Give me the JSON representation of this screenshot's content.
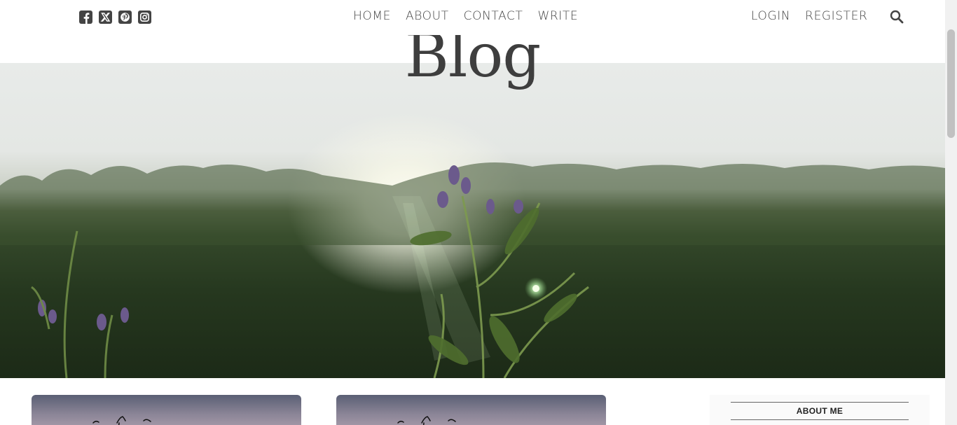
{
  "social": {
    "icons": [
      "facebook-icon",
      "x-twitter-icon",
      "pinterest-icon",
      "instagram-icon"
    ]
  },
  "nav": {
    "items": [
      "HOME",
      "ABOUT",
      "CONTACT",
      "WRITE"
    ]
  },
  "auth": {
    "login": "LOGIN",
    "register": "REGISTER"
  },
  "header": {
    "title": "Blog"
  },
  "sidebar": {
    "about_heading": "ABOUT ME"
  },
  "colors": {
    "text": "#444444",
    "title": "#3e3e3e"
  }
}
